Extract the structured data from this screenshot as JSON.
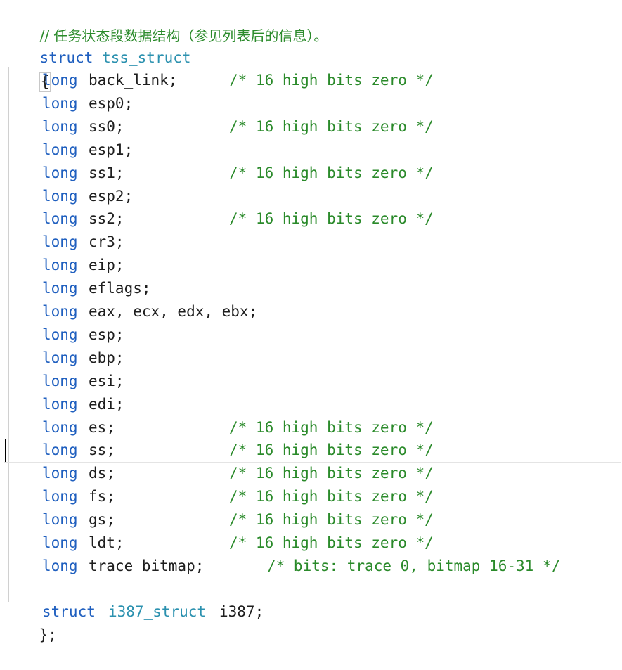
{
  "code": {
    "comment_cn": "// 任务状态段数据结构（参见列表后的信息）。",
    "struct_kw": "struct",
    "struct_name": "tss_struct",
    "open_brace": "{",
    "close_brace": "};",
    "fields": [
      {
        "type": "long",
        "name": "back_link;",
        "comment": "/* 16 high bits zero */"
      },
      {
        "type": "long",
        "name": "esp0;",
        "comment": ""
      },
      {
        "type": "long",
        "name": "ss0;",
        "comment": "/* 16 high bits zero */"
      },
      {
        "type": "long",
        "name": "esp1;",
        "comment": ""
      },
      {
        "type": "long",
        "name": "ss1;",
        "comment": "/* 16 high bits zero */"
      },
      {
        "type": "long",
        "name": "esp2;",
        "comment": ""
      },
      {
        "type": "long",
        "name": "ss2;",
        "comment": "/* 16 high bits zero */"
      },
      {
        "type": "long",
        "name": "cr3;",
        "comment": ""
      },
      {
        "type": "long",
        "name": "eip;",
        "comment": ""
      },
      {
        "type": "long",
        "name": "eflags;",
        "comment": ""
      },
      {
        "type": "long",
        "name": "eax, ecx, edx, ebx;",
        "comment": ""
      },
      {
        "type": "long",
        "name": "esp;",
        "comment": ""
      },
      {
        "type": "long",
        "name": "ebp;",
        "comment": ""
      },
      {
        "type": "long",
        "name": "esi;",
        "comment": ""
      },
      {
        "type": "long",
        "name": "edi;",
        "comment": ""
      },
      {
        "type": "long",
        "name": "es;",
        "comment": "/* 16 high bits zero */"
      },
      {
        "type": "long",
        "name": "ss;",
        "comment": "/* 16 high bits zero */"
      },
      {
        "type": "long",
        "name": "ds;",
        "comment": "/* 16 high bits zero */"
      },
      {
        "type": "long",
        "name": "fs;",
        "comment": "/* 16 high bits zero */"
      },
      {
        "type": "long",
        "name": "gs;",
        "comment": "/* 16 high bits zero */"
      },
      {
        "type": "long",
        "name": "ldt;",
        "comment": "/* 16 high bits zero */"
      },
      {
        "type": "long",
        "name": "trace_bitmap;",
        "comment": "/* bits: trace 0, bitmap 16-31 */"
      }
    ],
    "last_field": {
      "kw": "struct",
      "type": "i387_struct",
      "name": "i387;"
    }
  },
  "colors": {
    "keyword": "#1f5fbf",
    "type": "#2b91af",
    "comment": "#2a8a2a",
    "text": "#1e1e1e"
  }
}
